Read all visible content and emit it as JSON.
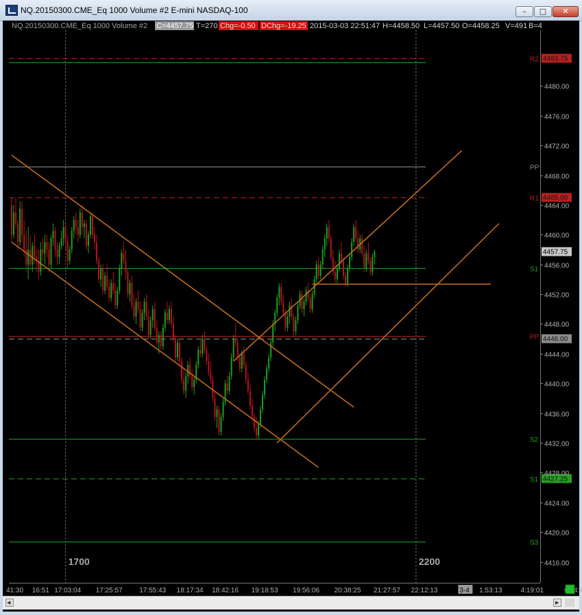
{
  "window": {
    "title": "NQ.20150300.CME_Eq  1000 Volume  #2  E-mini NASDAQ-100"
  },
  "header": {
    "symbol": "NQ.20150300.CME_Eq  1000 Volume  #2",
    "close": "C=4457.75",
    "trades": "T=270",
    "chg": "Chg=-0.50",
    "dchg": "DChg=-19.25",
    "datetime": "2015-03-03 22:51:47",
    "high": "H=4458.50",
    "low": "L=4457.50",
    "open": "O=4458.25",
    "volume": "V=491",
    "bid": "B=4"
  },
  "colors": {
    "background": "#000000",
    "up": "#1ea01e",
    "down": "#b4141e",
    "channel": "#c06a1e",
    "support": "#22a022",
    "resistance": "#b82020",
    "pivot": "#8c8c8c"
  },
  "chart_data": {
    "type": "candlestick",
    "ylim": [
      4413.2,
      4487.5
    ],
    "yticks": [
      4416,
      4420,
      4424,
      4428,
      4432,
      4436,
      4440,
      4444,
      4448,
      4452,
      4456,
      4460,
      4464,
      4468,
      4472,
      4476,
      4480
    ],
    "ytick_labels": [
      "4416.00",
      "4420.00",
      "4424.00",
      "4428.00",
      "4432.00",
      "4436.00",
      "4440.00",
      "4444.00",
      "4448.00",
      "4452.00",
      "4456.00",
      "4460.00",
      "4464.00",
      "4468.00",
      "4472.00",
      "4476.00",
      "4480.00"
    ],
    "xtick_labels": [
      "41:30",
      "16:51",
      "17:03:04",
      "17:25:57",
      "17:55:43",
      "18:17:34",
      "18:42:16",
      "19:18:53",
      "19:56:06",
      "20:38:25",
      "21:27:57",
      "22:12:13",
      "3-4",
      "1:53:13",
      "4:19:01",
      "6:44:49"
    ],
    "xtick_index": [
      0,
      14,
      27,
      47,
      68,
      86,
      103,
      122,
      142,
      162,
      181,
      199,
      216,
      231,
      251,
      272
    ],
    "session_markers": [
      {
        "label": "1700",
        "index": 26
      },
      {
        "label": "2200",
        "index": 195
      }
    ],
    "levels": [
      {
        "label": "R2",
        "value": 4483.75,
        "tag": "4483.75",
        "style": "dashed",
        "color": "#b82020"
      },
      {
        "label": "",
        "value": 4483.15,
        "tag": "",
        "style": "solid",
        "color": "#22a022"
      },
      {
        "label": "PP",
        "value": 4469.2,
        "tag": "",
        "style": "solid",
        "color": "#8c8c8c"
      },
      {
        "label": "R1",
        "value": 4465.0,
        "tag": "4465.00",
        "style": "dashed",
        "color": "#b82020"
      },
      {
        "label": "S1",
        "value": 4455.5,
        "tag": "",
        "style": "solid",
        "color": "#22a022"
      },
      {
        "label": "PP",
        "value": 4446.35,
        "tag": "",
        "style": "solid",
        "color": "#b82020"
      },
      {
        "label": "",
        "value": 4446.0,
        "tag": "4446.00",
        "style": "dashed",
        "color": "#8c8c8c"
      },
      {
        "label": "S2",
        "value": 4432.55,
        "tag": "",
        "style": "solid",
        "color": "#22a022"
      },
      {
        "label": "S1",
        "value": 4427.25,
        "tag": "4427.25",
        "style": "dashed",
        "color": "#22a022"
      },
      {
        "label": "S3",
        "value": 4418.75,
        "tag": "",
        "style": "solid",
        "color": "#22a022"
      }
    ],
    "last_price": {
      "value": 4457.75,
      "tag": "4457.75"
    },
    "trendlines": [
      {
        "x1": 0,
        "y1": 4470.7,
        "x2": 165,
        "y2": 4436.8
      },
      {
        "x1": 0,
        "y1": 4459.0,
        "x2": 148,
        "y2": 4428.7
      },
      {
        "x1": 107,
        "y1": 4443.0,
        "x2": 217,
        "y2": 4471.3
      },
      {
        "x1": 128,
        "y1": 4432.0,
        "x2": 235,
        "y2": 4461.5
      },
      {
        "x1": 145,
        "y1": 4453.35,
        "x2": 231,
        "y2": 4453.35
      }
    ],
    "ohlc": [
      [
        4464.0,
        4465.0,
        4459.0,
        4460.0
      ],
      [
        4460.0,
        4464.0,
        4459.5,
        4463.0
      ],
      [
        4463.0,
        4465.0,
        4461.0,
        4461.5
      ],
      [
        4461.5,
        4462.0,
        4458.0,
        4459.0
      ],
      [
        4459.0,
        4464.5,
        4458.5,
        4463.5
      ],
      [
        4463.5,
        4464.5,
        4459.0,
        4460.0
      ],
      [
        4460.0,
        4462.0,
        4457.0,
        4458.0
      ],
      [
        4458.0,
        4460.5,
        4455.0,
        4456.0
      ],
      [
        4456.0,
        4461.0,
        4454.0,
        4458.0
      ],
      [
        4458.0,
        4460.0,
        4455.5,
        4456.0
      ],
      [
        4456.0,
        4459.0,
        4455.0,
        4458.5
      ],
      [
        4458.5,
        4460.0,
        4456.0,
        4457.0
      ],
      [
        4457.0,
        4458.0,
        4455.0,
        4456.5
      ],
      [
        4456.5,
        4458.0,
        4454.0,
        4455.0
      ],
      [
        4455.0,
        4459.0,
        4454.5,
        4458.0
      ],
      [
        4458.0,
        4459.5,
        4456.5,
        4457.5
      ],
      [
        4457.5,
        4460.0,
        4456.0,
        4459.0
      ],
      [
        4459.0,
        4460.0,
        4457.0,
        4458.0
      ],
      [
        4458.0,
        4459.0,
        4455.0,
        4456.0
      ],
      [
        4456.0,
        4460.0,
        4455.5,
        4459.5
      ],
      [
        4459.5,
        4461.5,
        4458.5,
        4460.5
      ],
      [
        4460.5,
        4461.0,
        4457.0,
        4458.0
      ],
      [
        4458.0,
        4459.0,
        4456.0,
        4457.0
      ],
      [
        4457.0,
        4459.0,
        4456.0,
        4458.5
      ],
      [
        4458.5,
        4460.5,
        4458.0,
        4459.5
      ],
      [
        4459.5,
        4462.0,
        4458.5,
        4461.0
      ],
      [
        4461.0,
        4461.5,
        4458.0,
        4459.0
      ],
      [
        4459.0,
        4460.0,
        4455.5,
        4456.5
      ],
      [
        4456.5,
        4458.5,
        4456.0,
        4458.0
      ],
      [
        4458.0,
        4461.0,
        4457.5,
        4460.5
      ],
      [
        4460.5,
        4462.5,
        4459.5,
        4462.0
      ],
      [
        4462.0,
        4463.0,
        4460.0,
        4461.0
      ],
      [
        4461.0,
        4462.0,
        4459.0,
        4460.0
      ],
      [
        4460.0,
        4463.5,
        4459.5,
        4463.0
      ],
      [
        4463.0,
        4464.0,
        4460.0,
        4461.0
      ],
      [
        4461.0,
        4462.0,
        4459.5,
        4461.5
      ],
      [
        4461.5,
        4462.0,
        4458.0,
        4458.5
      ],
      [
        4458.5,
        4460.5,
        4457.5,
        4460.0
      ],
      [
        4460.0,
        4463.0,
        4459.5,
        4462.5
      ],
      [
        4462.5,
        4463.0,
        4459.5,
        4460.0
      ],
      [
        4460.0,
        4461.0,
        4458.0,
        4459.0
      ],
      [
        4459.0,
        4460.0,
        4456.0,
        4456.5
      ],
      [
        4456.5,
        4457.0,
        4453.5,
        4454.0
      ],
      [
        4454.0,
        4456.0,
        4453.0,
        4455.5
      ],
      [
        4455.5,
        4456.0,
        4452.0,
        4452.5
      ],
      [
        4452.5,
        4455.0,
        4452.0,
        4454.5
      ],
      [
        4454.5,
        4456.0,
        4452.5,
        4453.0
      ],
      [
        4453.0,
        4454.0,
        4451.0,
        4451.5
      ],
      [
        4451.5,
        4454.0,
        4451.0,
        4453.5
      ],
      [
        4453.5,
        4455.0,
        4452.0,
        4452.5
      ],
      [
        4452.5,
        4453.5,
        4450.0,
        4450.5
      ],
      [
        4450.5,
        4453.0,
        4450.0,
        4452.5
      ],
      [
        4452.5,
        4456.0,
        4452.0,
        4455.5
      ],
      [
        4455.5,
        4458.0,
        4454.5,
        4457.5
      ],
      [
        4457.5,
        4459.0,
        4456.0,
        4456.5
      ],
      [
        4456.5,
        4458.0,
        4454.0,
        4455.0
      ],
      [
        4455.0,
        4455.5,
        4451.5,
        4452.0
      ],
      [
        4452.0,
        4454.0,
        4451.0,
        4453.5
      ],
      [
        4453.5,
        4454.5,
        4450.0,
        4450.5
      ],
      [
        4450.5,
        4452.0,
        4448.5,
        4449.0
      ],
      [
        4449.0,
        4451.5,
        4448.0,
        4451.0
      ],
      [
        4451.0,
        4452.5,
        4449.5,
        4450.0
      ],
      [
        4450.0,
        4451.0,
        4447.0,
        4447.5
      ],
      [
        4447.5,
        4450.0,
        4447.0,
        4449.5
      ],
      [
        4449.5,
        4451.5,
        4448.5,
        4451.0
      ],
      [
        4451.0,
        4452.0,
        4448.5,
        4449.0
      ],
      [
        4449.0,
        4450.0,
        4446.0,
        4446.5
      ],
      [
        4446.5,
        4449.0,
        4446.0,
        4448.5
      ],
      [
        4448.5,
        4450.5,
        4447.5,
        4450.0
      ],
      [
        4450.0,
        4451.0,
        4447.0,
        4447.5
      ],
      [
        4447.5,
        4448.5,
        4445.0,
        4445.5
      ],
      [
        4445.5,
        4447.0,
        4444.0,
        4446.5
      ],
      [
        4446.5,
        4447.0,
        4444.5,
        4445.0
      ],
      [
        4445.0,
        4448.0,
        4444.5,
        4447.5
      ],
      [
        4447.5,
        4450.0,
        4447.0,
        4449.5
      ],
      [
        4449.5,
        4451.0,
        4448.0,
        4448.5
      ],
      [
        4448.5,
        4450.5,
        4448.0,
        4450.0
      ],
      [
        4450.0,
        4451.0,
        4447.5,
        4448.0
      ],
      [
        4448.0,
        4449.0,
        4445.5,
        4446.0
      ],
      [
        4446.0,
        4446.5,
        4443.0,
        4443.5
      ],
      [
        4443.5,
        4446.0,
        4443.0,
        4445.5
      ],
      [
        4445.5,
        4446.0,
        4442.5,
        4443.0
      ],
      [
        4443.0,
        4443.5,
        4440.0,
        4440.5
      ],
      [
        4440.5,
        4442.0,
        4438.5,
        4439.0
      ],
      [
        4439.0,
        4441.5,
        4438.0,
        4441.0
      ],
      [
        4441.0,
        4443.0,
        4440.0,
        4442.5
      ],
      [
        4442.5,
        4443.5,
        4440.5,
        4441.0
      ],
      [
        4441.0,
        4442.0,
        4439.0,
        4439.5
      ],
      [
        4439.5,
        4441.0,
        4438.5,
        4440.5
      ],
      [
        4440.5,
        4443.0,
        4440.0,
        4442.5
      ],
      [
        4442.5,
        4445.0,
        4442.0,
        4444.5
      ],
      [
        4444.5,
        4446.0,
        4443.5,
        4444.0
      ],
      [
        4444.0,
        4446.5,
        4443.5,
        4446.0
      ],
      [
        4446.0,
        4447.0,
        4444.0,
        4444.5
      ],
      [
        4444.5,
        4445.0,
        4442.5,
        4443.0
      ],
      [
        4443.0,
        4444.0,
        4441.0,
        4441.5
      ],
      [
        4441.5,
        4443.0,
        4440.0,
        4440.5
      ],
      [
        4440.5,
        4441.0,
        4437.5,
        4438.0
      ],
      [
        4438.0,
        4439.0,
        4435.0,
        4435.5
      ],
      [
        4435.5,
        4437.0,
        4434.0,
        4436.5
      ],
      [
        4436.5,
        4437.0,
        4433.0,
        4433.5
      ],
      [
        4433.5,
        4436.0,
        4433.0,
        4435.5
      ],
      [
        4435.5,
        4438.0,
        4435.0,
        4437.5
      ],
      [
        4437.5,
        4440.5,
        4437.0,
        4440.0
      ],
      [
        4440.0,
        4441.0,
        4438.5,
        4439.0
      ],
      [
        4439.0,
        4441.5,
        4438.5,
        4441.0
      ],
      [
        4441.0,
        4444.0,
        4440.5,
        4443.5
      ],
      [
        4443.5,
        4446.5,
        4443.0,
        4446.0
      ],
      [
        4446.0,
        4448.0,
        4445.0,
        4445.5
      ],
      [
        4445.5,
        4446.0,
        4443.0,
        4443.5
      ],
      [
        4443.5,
        4444.0,
        4441.5,
        4442.0
      ],
      [
        4442.0,
        4444.5,
        4441.5,
        4444.0
      ],
      [
        4444.0,
        4445.0,
        4442.0,
        4442.5
      ],
      [
        4442.5,
        4443.0,
        4440.0,
        4440.5
      ],
      [
        4440.5,
        4441.5,
        4438.5,
        4439.0
      ],
      [
        4439.0,
        4440.0,
        4436.5,
        4437.0
      ],
      [
        4437.0,
        4438.0,
        4435.0,
        4435.5
      ],
      [
        4435.5,
        4436.0,
        4433.5,
        4434.0
      ],
      [
        4434.0,
        4435.5,
        4432.5,
        4433.0
      ],
      [
        4433.0,
        4435.0,
        4432.5,
        4434.5
      ],
      [
        4434.5,
        4437.0,
        4434.0,
        4436.5
      ],
      [
        4436.5,
        4439.0,
        4436.0,
        4438.5
      ],
      [
        4438.5,
        4441.0,
        4438.0,
        4440.5
      ],
      [
        4440.5,
        4442.5,
        4440.0,
        4442.0
      ],
      [
        4442.0,
        4444.0,
        4441.5,
        4443.5
      ],
      [
        4443.5,
        4446.0,
        4443.0,
        4445.5
      ],
      [
        4445.5,
        4448.5,
        4445.0,
        4448.0
      ],
      [
        4448.0,
        4450.0,
        4447.0,
        4449.5
      ],
      [
        4449.5,
        4452.0,
        4449.0,
        4451.5
      ],
      [
        4451.5,
        4453.5,
        4450.5,
        4453.0
      ],
      [
        4453.0,
        4453.5,
        4450.5,
        4451.0
      ],
      [
        4451.0,
        4452.0,
        4449.0,
        4449.5
      ],
      [
        4449.5,
        4450.0,
        4447.0,
        4447.5
      ],
      [
        4447.5,
        4449.5,
        4447.0,
        4449.0
      ],
      [
        4449.0,
        4451.0,
        4448.0,
        4450.5
      ],
      [
        4450.5,
        4451.5,
        4448.5,
        4449.0
      ],
      [
        4449.0,
        4449.5,
        4446.5,
        4447.0
      ],
      [
        4447.0,
        4449.0,
        4446.5,
        4448.5
      ],
      [
        4448.5,
        4451.0,
        4448.0,
        4450.5
      ],
      [
        4450.5,
        4452.5,
        4450.0,
        4452.0
      ],
      [
        4452.0,
        4452.5,
        4449.5,
        4450.0
      ],
      [
        4450.0,
        4451.5,
        4449.0,
        4451.0
      ],
      [
        4451.0,
        4453.0,
        4450.5,
        4452.5
      ],
      [
        4452.5,
        4453.5,
        4451.0,
        4451.5
      ],
      [
        4451.5,
        4452.0,
        4449.5,
        4450.0
      ],
      [
        4450.0,
        4452.5,
        4449.5,
        4452.0
      ],
      [
        4452.0,
        4454.5,
        4451.5,
        4454.0
      ],
      [
        4454.0,
        4456.5,
        4453.5,
        4456.0
      ],
      [
        4456.0,
        4457.0,
        4454.0,
        4454.5
      ],
      [
        4454.5,
        4456.5,
        4454.0,
        4456.0
      ],
      [
        4456.0,
        4458.5,
        4455.5,
        4458.0
      ],
      [
        4458.0,
        4460.0,
        4457.0,
        4459.5
      ],
      [
        4459.5,
        4461.5,
        4458.5,
        4461.0
      ],
      [
        4461.0,
        4462.0,
        4459.0,
        4459.5
      ],
      [
        4459.5,
        4460.0,
        4456.5,
        4457.0
      ],
      [
        4457.0,
        4458.0,
        4454.5,
        4455.0
      ],
      [
        4455.0,
        4456.5,
        4453.5,
        4454.0
      ],
      [
        4454.0,
        4456.0,
        4453.5,
        4455.5
      ],
      [
        4455.5,
        4458.0,
        4455.0,
        4457.5
      ],
      [
        4457.5,
        4459.0,
        4456.0,
        4456.5
      ],
      [
        4456.5,
        4457.0,
        4454.0,
        4454.5
      ],
      [
        4454.5,
        4455.0,
        4453.0,
        4453.5
      ],
      [
        4453.5,
        4456.0,
        4453.0,
        4455.5
      ],
      [
        4455.5,
        4457.5,
        4455.0,
        4457.0
      ],
      [
        4457.0,
        4459.5,
        4456.5,
        4459.0
      ],
      [
        4459.0,
        4461.5,
        4458.5,
        4461.0
      ],
      [
        4461.0,
        4462.0,
        4459.0,
        4459.5
      ],
      [
        4459.5,
        4460.5,
        4457.5,
        4458.0
      ],
      [
        4458.0,
        4460.0,
        4457.5,
        4459.5
      ],
      [
        4459.5,
        4460.0,
        4457.0,
        4457.5
      ],
      [
        4457.5,
        4458.5,
        4455.0,
        4455.5
      ],
      [
        4455.5,
        4458.0,
        4455.0,
        4457.5
      ],
      [
        4457.5,
        4459.0,
        4456.0,
        4456.5
      ],
      [
        4456.5,
        4457.0,
        4454.5,
        4455.0
      ],
      [
        4455.0,
        4457.5,
        4454.5,
        4457.0
      ],
      [
        4457.0,
        4458.0,
        4456.0,
        4457.75
      ]
    ]
  },
  "statusbar": {
    "left_arrow": "◀",
    "right_arrow": "▶"
  }
}
